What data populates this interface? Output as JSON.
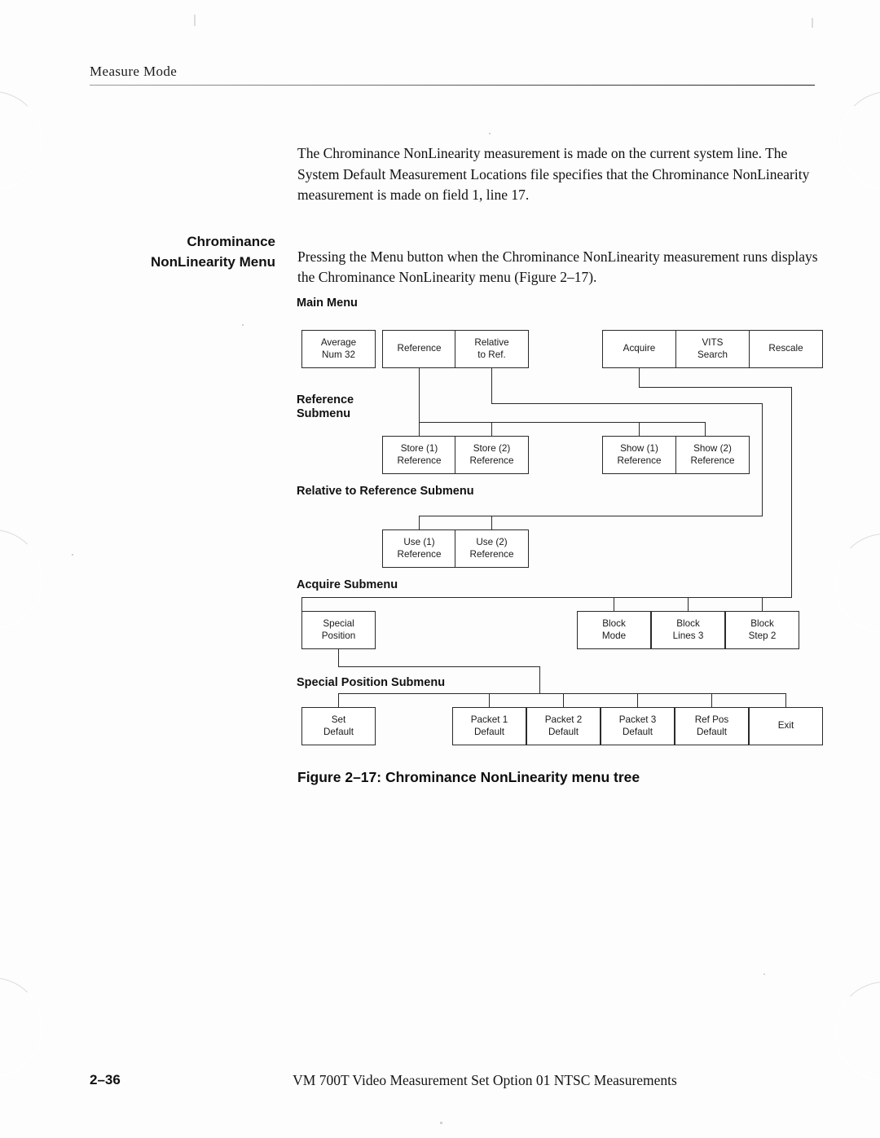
{
  "page": {
    "running_head": "Measure Mode",
    "folio": "2–36",
    "footer_title": "VM 700T Video Measurement Set Option 01 NTSC Measurements"
  },
  "body": {
    "intro_paragraph": "The Chrominance NonLinearity measurement is made on the current system line. The System Default Measurement Locations file specifies that the Chrominance NonLinearity measurement is made on field 1, line 17.",
    "side_heading": "Chrominance\nNonLinearity Menu",
    "menu_paragraph": "Pressing the Menu button when the Chrominance NonLinearity measurement runs displays the Chrominance NonLinearity menu (Figure 2–17)."
  },
  "figure": {
    "caption": "Figure 2–17: Chrominance NonLinearity menu tree",
    "sections": [
      {
        "id": "main-menu",
        "label": "Main Menu"
      },
      {
        "id": "reference-submenu",
        "label": "Reference\nSubmenu"
      },
      {
        "id": "relative-to-reference-submenu",
        "label": "Relative to Reference Submenu"
      },
      {
        "id": "acquire-submenu",
        "label": "Acquire Submenu"
      },
      {
        "id": "special-position-submenu",
        "label": "Special Position Submenu"
      }
    ],
    "nodes": {
      "average_num": {
        "line1": "Average",
        "line2": "Num 32"
      },
      "reference": {
        "line1": "Reference",
        "line2": ""
      },
      "relative_to_ref": {
        "line1": "Relative",
        "line2": "to Ref."
      },
      "acquire": {
        "line1": "Acquire",
        "line2": ""
      },
      "vits_search": {
        "line1": "VITS",
        "line2": "Search"
      },
      "rescale": {
        "line1": "Rescale",
        "line2": ""
      },
      "store1": {
        "line1": "Store (1)",
        "line2": "Reference"
      },
      "store2": {
        "line1": "Store (2)",
        "line2": "Reference"
      },
      "show1": {
        "line1": "Show (1)",
        "line2": "Reference"
      },
      "show2": {
        "line1": "Show (2)",
        "line2": "Reference"
      },
      "use1": {
        "line1": "Use (1)",
        "line2": "Reference"
      },
      "use2": {
        "line1": "Use (2)",
        "line2": "Reference"
      },
      "special_position": {
        "line1": "Special",
        "line2": "Position"
      },
      "block_mode": {
        "line1": "Block",
        "line2": "Mode"
      },
      "block_lines": {
        "line1": "Block",
        "line2": "Lines 3"
      },
      "block_step": {
        "line1": "Block",
        "line2": "Step 2"
      },
      "set_default": {
        "line1": "Set",
        "line2": "Default"
      },
      "packet1": {
        "line1": "Packet 1",
        "line2": "Default"
      },
      "packet2": {
        "line1": "Packet 2",
        "line2": "Default"
      },
      "packet3": {
        "line1": "Packet 3",
        "line2": "Default"
      },
      "ref_pos": {
        "line1": "Ref Pos",
        "line2": "Default"
      },
      "exit": {
        "line1": "Exit",
        "line2": ""
      }
    }
  },
  "colors": {
    "ink": "#1a1a1a",
    "rule": "#222222",
    "paper": "#fdfdfd"
  }
}
